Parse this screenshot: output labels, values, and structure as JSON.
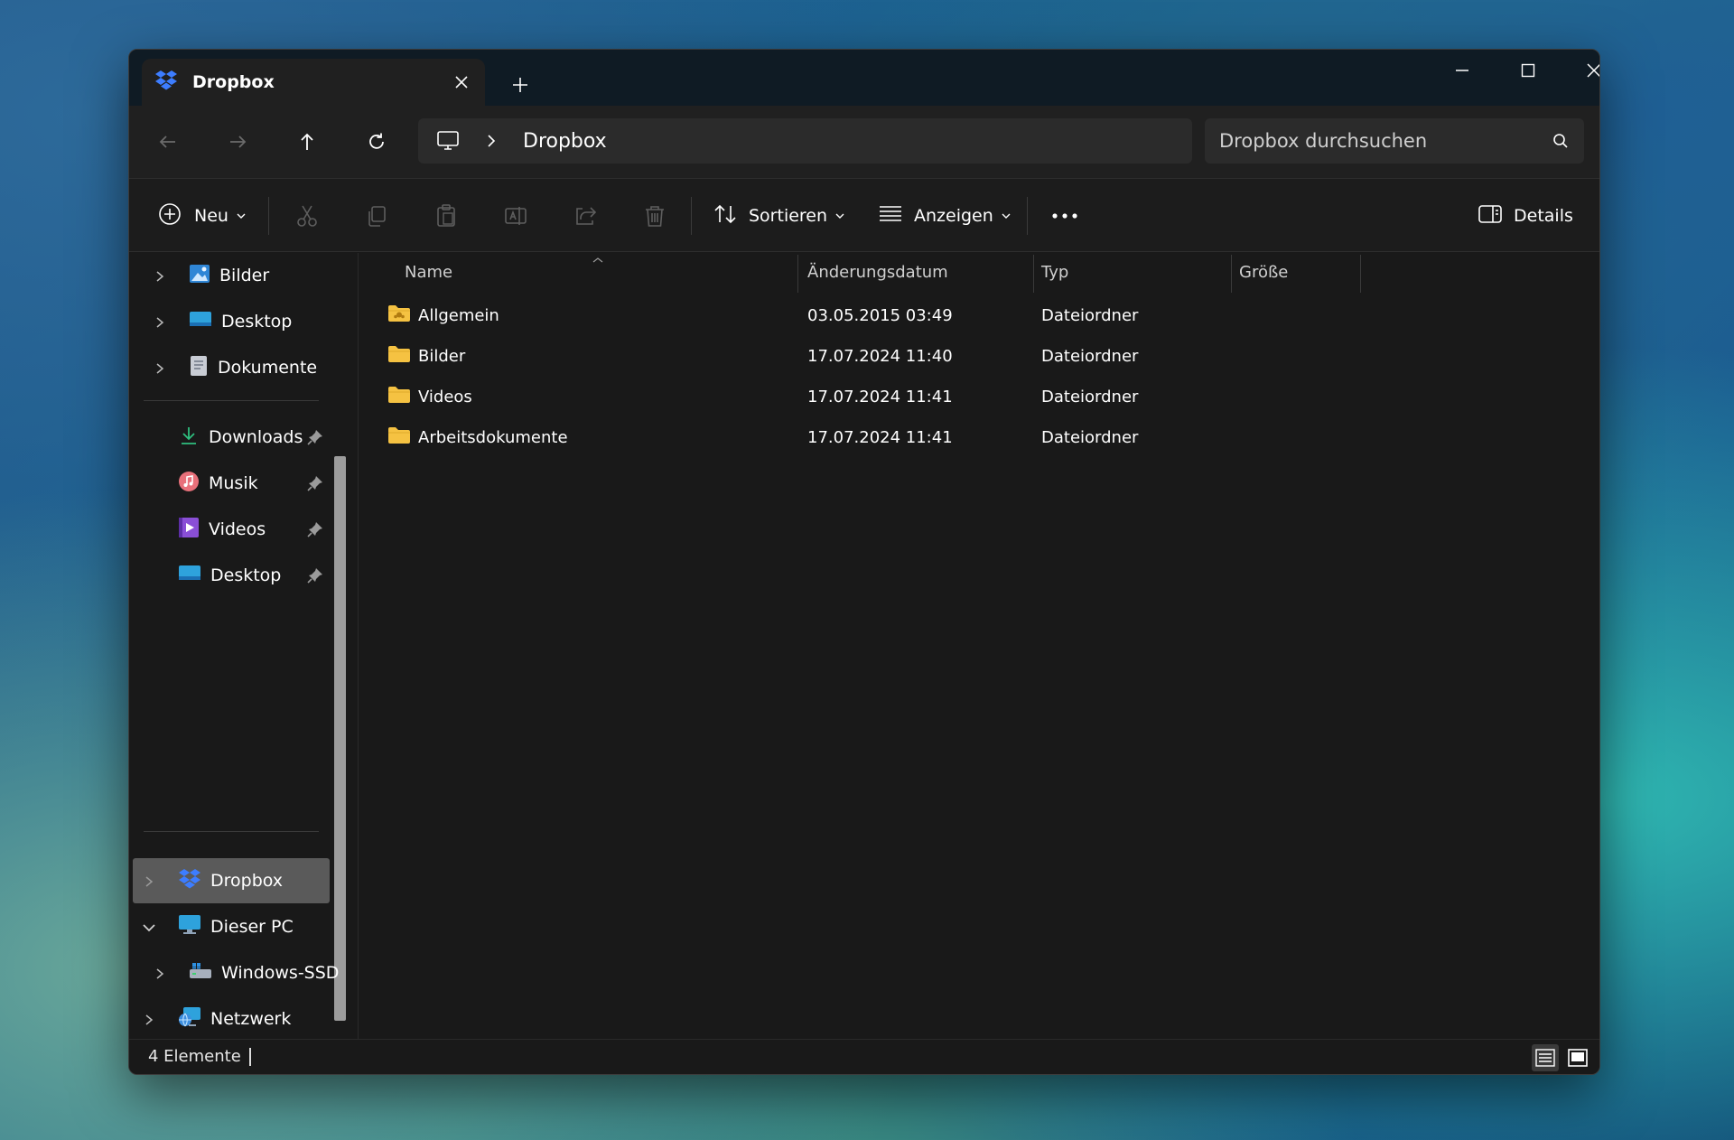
{
  "window": {
    "tab_title": "Dropbox",
    "controls": {
      "minimize": "minimize-icon",
      "maximize": "maximize-icon",
      "close": "close-icon"
    }
  },
  "navigation": {
    "address": {
      "path": "Dropbox"
    },
    "search": {
      "placeholder": "Dropbox durchsuchen"
    }
  },
  "toolbar": {
    "new_label": "Neu",
    "sort_label": "Sortieren",
    "view_label": "Anzeigen",
    "details_label": "Details"
  },
  "sidebar": {
    "items": [
      {
        "label": "Bilder"
      },
      {
        "label": "Desktop"
      },
      {
        "label": "Dokumente"
      },
      {
        "label": "Downloads"
      },
      {
        "label": "Musik"
      },
      {
        "label": "Videos"
      },
      {
        "label": "Desktop"
      },
      {
        "label": "Dropbox"
      },
      {
        "label": "Dieser PC"
      },
      {
        "label": "Windows-SSD"
      },
      {
        "label": "Netzwerk"
      }
    ]
  },
  "file_list": {
    "columns": {
      "name": "Name",
      "date": "Änderungsdatum",
      "type": "Typ",
      "size": "Größe"
    },
    "rows": [
      {
        "name": "Allgemein",
        "date": "03.05.2015 03:49",
        "type": "Dateiordner",
        "size": ""
      },
      {
        "name": "Bilder",
        "date": "17.07.2024 11:40",
        "type": "Dateiordner",
        "size": ""
      },
      {
        "name": "Videos",
        "date": "17.07.2024 11:41",
        "type": "Dateiordner",
        "size": ""
      },
      {
        "name": "Arbeitsdokumente",
        "date": "17.07.2024 11:41",
        "type": "Dateiordner",
        "size": ""
      }
    ]
  },
  "status": {
    "count": "4 Elemente"
  },
  "colors": {
    "accent_folder": "#f5c242",
    "dropbox_blue": "#3d7dff",
    "selection": "#5a5a5a"
  }
}
